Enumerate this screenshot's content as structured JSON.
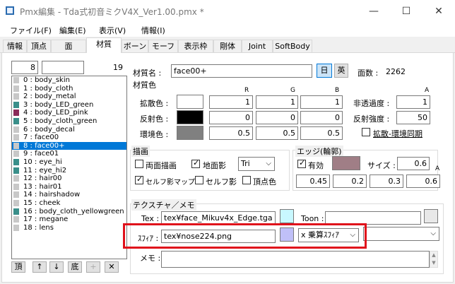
{
  "window": {
    "title": "Pmx編集 - Tda式初音ミクV4X_Ver1.00.pmx *",
    "minimize": "—",
    "maximize": "☐",
    "close": "✕"
  },
  "menu": [
    "ファイル(F)",
    "編集(E)",
    "表示(V)",
    "情報(I)"
  ],
  "tabs": [
    "情報",
    "頂点",
    "面",
    "材質",
    "ボーン",
    "モーフ",
    "表示枠",
    "剛体",
    "Joint",
    "SoftBody"
  ],
  "left": {
    "index": "8",
    "name_field": "",
    "count": "19",
    "items": [
      {
        "label": "0 : body_skin",
        "color": "#c8c8c8"
      },
      {
        "label": "1 : body_cloth",
        "color": "#c8c8c8"
      },
      {
        "label": "2 : body_metal",
        "color": "#c8c8c8"
      },
      {
        "label": "3 : body_LED_green",
        "color": "#3a8f8a"
      },
      {
        "label": "4 : body_LED_pink",
        "color": "#8a2c5a"
      },
      {
        "label": "5 : body_cloth_green",
        "color": "#3a8f8a"
      },
      {
        "label": "6 : body_decal",
        "color": "#c8c8c8"
      },
      {
        "label": "7 : face00",
        "color": "#c8c8c8"
      },
      {
        "label": "8 : face00+",
        "color": "#c8c8c8"
      },
      {
        "label": "9 : face01",
        "color": "#c8c8c8"
      },
      {
        "label": "10 : eye_hi",
        "color": "#3a8f8a"
      },
      {
        "label": "11 : eye_hi2",
        "color": "#3a8f8a"
      },
      {
        "label": "12 : hair00",
        "color": "#c8c8c8"
      },
      {
        "label": "13 : hair01",
        "color": "#c8c8c8"
      },
      {
        "label": "14 : hairshadow",
        "color": "#c8c8c8"
      },
      {
        "label": "15 : cheek",
        "color": "#c8c8c8"
      },
      {
        "label": "16 : body_cloth_yellowgreen",
        "color": "#3a8f8a"
      },
      {
        "label": "17 : megane",
        "color": "#c8c8c8"
      },
      {
        "label": "18 : lens",
        "color": "#c8c8c8"
      }
    ],
    "buttons": [
      "頂",
      "↑",
      "↓",
      "底",
      "+",
      "✕"
    ]
  },
  "material": {
    "name_label": "材質名 :",
    "name": "face00+",
    "jp_btn": "日",
    "en_btn": "英",
    "face_count_label": "面数 :",
    "face_count": "2262",
    "color_group": "材質色",
    "col_headers": [
      "R",
      "G",
      "B",
      "A"
    ],
    "diffuse_label": "拡散色 :",
    "diffuse": [
      "1",
      "1",
      "1"
    ],
    "diffuse_color": "#ffffff",
    "specular_label": "反射色 :",
    "specular": [
      "0",
      "0",
      "0"
    ],
    "specular_color": "#000000",
    "ambient_label": "環境色 :",
    "ambient": [
      "0.5",
      "0.5",
      "0.5"
    ],
    "ambient_color": "#808080",
    "alpha_label": "非透過度 :",
    "alpha": "1",
    "spec_power_label": "反射強度 :",
    "spec_power": "50",
    "sync_label": "拡散-環境同期"
  },
  "draw": {
    "group": "描画",
    "double_sided": "両面描画",
    "ground_shadow": "地面影",
    "shadow_type": "Tri",
    "self_shadow_map": "セルフ影マップ",
    "self_shadow": "セルフ影",
    "vertex_color": "頂点色"
  },
  "edge": {
    "group": "エッジ(輪郭)",
    "enabled": "有効",
    "edge_color": "#a07e86",
    "size_label": "サイズ :",
    "size": "0.6",
    "a_label": "A",
    "rgba": [
      "0.45",
      "0.2",
      "0.3",
      "0.6"
    ]
  },
  "texture": {
    "group": "テクスチャ／メモ",
    "tex_label": "Tex :",
    "tex_path": "tex¥face_Mikuv4x_Edge.tga",
    "tex_color": "#c8f8ff",
    "toon_label": "Toon :",
    "toon_path": "",
    "sphere_label": "ｽﾌｨｱ :",
    "sphere_path": "tex¥nose224.png",
    "sphere_color": "#c0c0f8",
    "sphere_mode": "x 乗算ｽﾌｨｱ",
    "memo_label": "メモ :",
    "memo": "",
    "highlight_color": "#e0111b"
  }
}
